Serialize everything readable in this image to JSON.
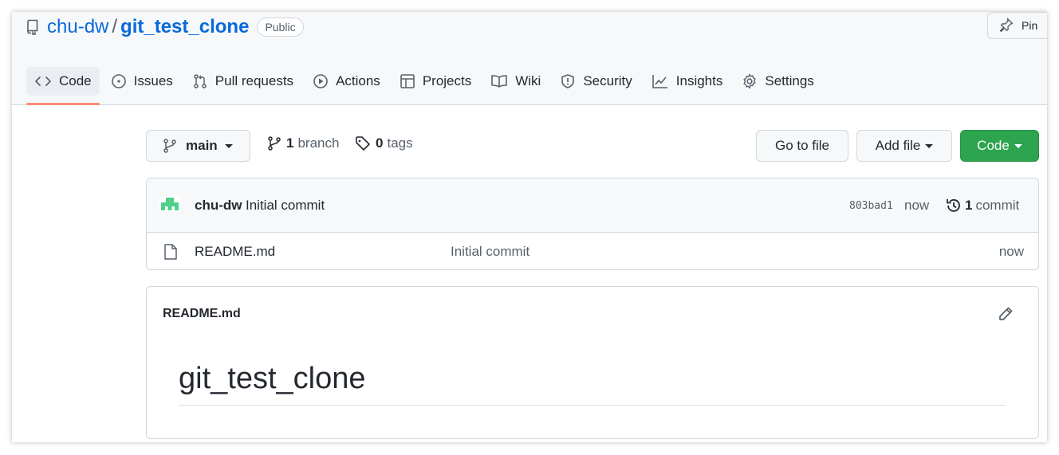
{
  "repo": {
    "owner": "chu-dw",
    "separator": "/",
    "name": "git_test_clone",
    "visibility": "Public",
    "pin_label": "Pin"
  },
  "tabs": [
    {
      "label": "Code",
      "icon": "code-icon",
      "active": true
    },
    {
      "label": "Issues",
      "icon": "issue-icon"
    },
    {
      "label": "Pull requests",
      "icon": "pull-request-icon"
    },
    {
      "label": "Actions",
      "icon": "play-icon"
    },
    {
      "label": "Projects",
      "icon": "table-icon"
    },
    {
      "label": "Wiki",
      "icon": "book-icon"
    },
    {
      "label": "Security",
      "icon": "shield-icon"
    },
    {
      "label": "Insights",
      "icon": "graph-icon"
    },
    {
      "label": "Settings",
      "icon": "gear-icon"
    }
  ],
  "toolbar": {
    "branch_selected": "main",
    "branch_count": "1",
    "branch_label": "branch",
    "tag_count": "0",
    "tag_label": "tags",
    "go_to_file": "Go to file",
    "add_file": "Add file",
    "code": "Code"
  },
  "latest_commit": {
    "author": "chu-dw",
    "message": "Initial commit",
    "sha": "803bad1",
    "time": "now",
    "commit_count": "1",
    "commit_label": "commit"
  },
  "files": [
    {
      "name": "README.md",
      "message": "Initial commit",
      "time": "now",
      "icon": "file-icon"
    }
  ],
  "readme": {
    "filename": "README.md",
    "heading": "git_test_clone"
  },
  "colors": {
    "link": "#0969da",
    "primary_button": "#2da44e",
    "active_tab_underline": "#fd8c73",
    "avatar": "#4fd18b"
  }
}
